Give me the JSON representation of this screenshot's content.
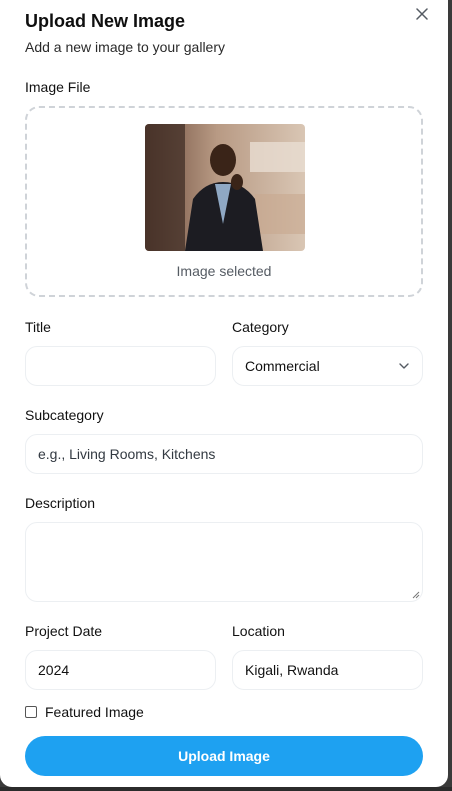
{
  "dialog": {
    "title": "Upload New Image",
    "subtitle": "Add a new image to your gallery"
  },
  "image_file": {
    "label": "Image File",
    "status": "Image selected",
    "preview_icon": "photo-preview"
  },
  "fields": {
    "title": {
      "label": "Title",
      "value": ""
    },
    "category": {
      "label": "Category",
      "value": "Commercial"
    },
    "subcategory": {
      "label": "Subcategory",
      "placeholder": "e.g., Living Rooms, Kitchens"
    },
    "description": {
      "label": "Description",
      "value": ""
    },
    "project_date": {
      "label": "Project Date",
      "value": "2024"
    },
    "location": {
      "label": "Location",
      "value": "Kigali, Rwanda"
    }
  },
  "featured": {
    "label": "Featured Image",
    "checked": false
  },
  "submit": {
    "label": "Upload Image"
  },
  "colors": {
    "accent": "#1ea1f1",
    "border": "#eceff2",
    "dashed_border": "#cfd3d8"
  }
}
